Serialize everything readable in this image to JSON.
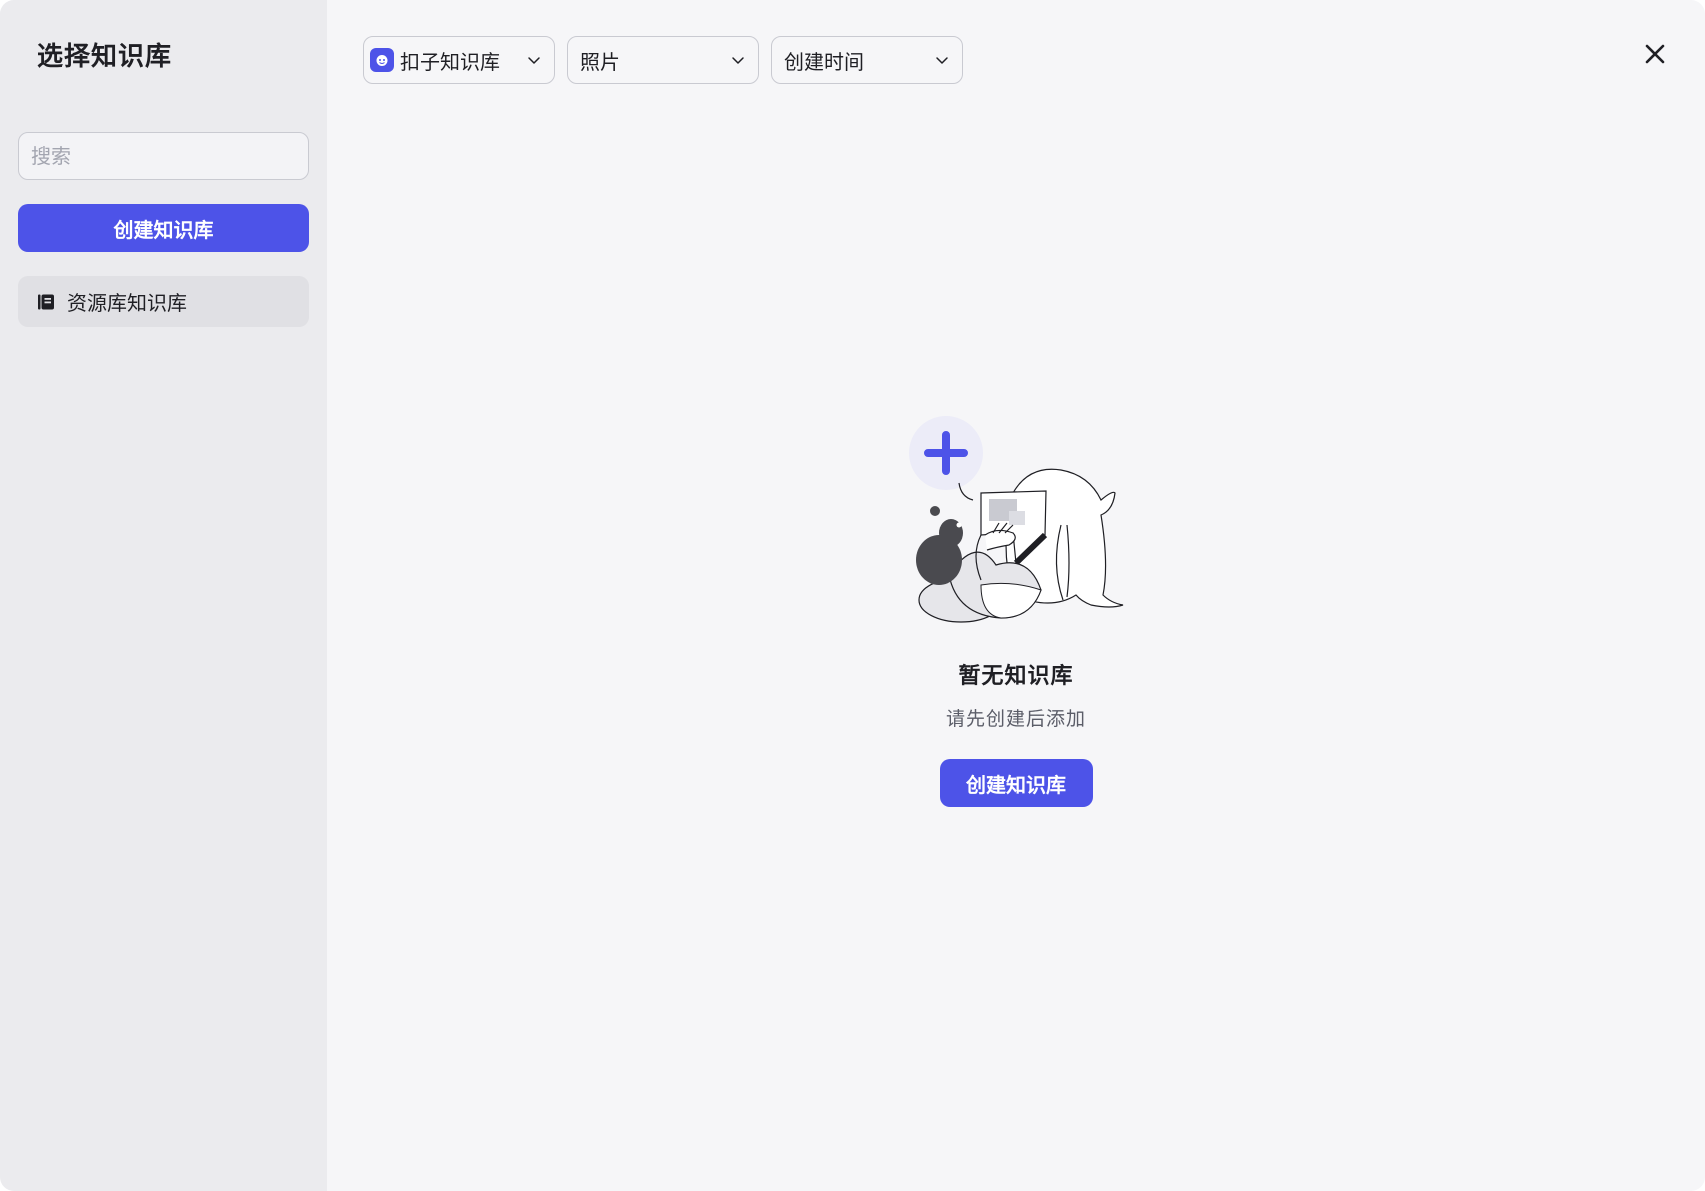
{
  "sidebar": {
    "title": "选择知识库",
    "search_placeholder": "搜索",
    "create_label": "创建知识库",
    "items": [
      {
        "label": "资源库知识库",
        "icon": "book-icon"
      }
    ]
  },
  "toolbar": {
    "source_select": {
      "value": "扣子知识库",
      "icon": "coze-logo-icon"
    },
    "type_select": {
      "value": "照片"
    },
    "sort_select": {
      "value": "创建时间"
    }
  },
  "empty_state": {
    "title": "暂无知识库",
    "subtitle": "请先创建后添加",
    "create_label": "创建知识库"
  },
  "colors": {
    "accent": "#4d53e8",
    "sidebar_bg": "#ebebee",
    "main_bg": "#f6f6f8"
  }
}
